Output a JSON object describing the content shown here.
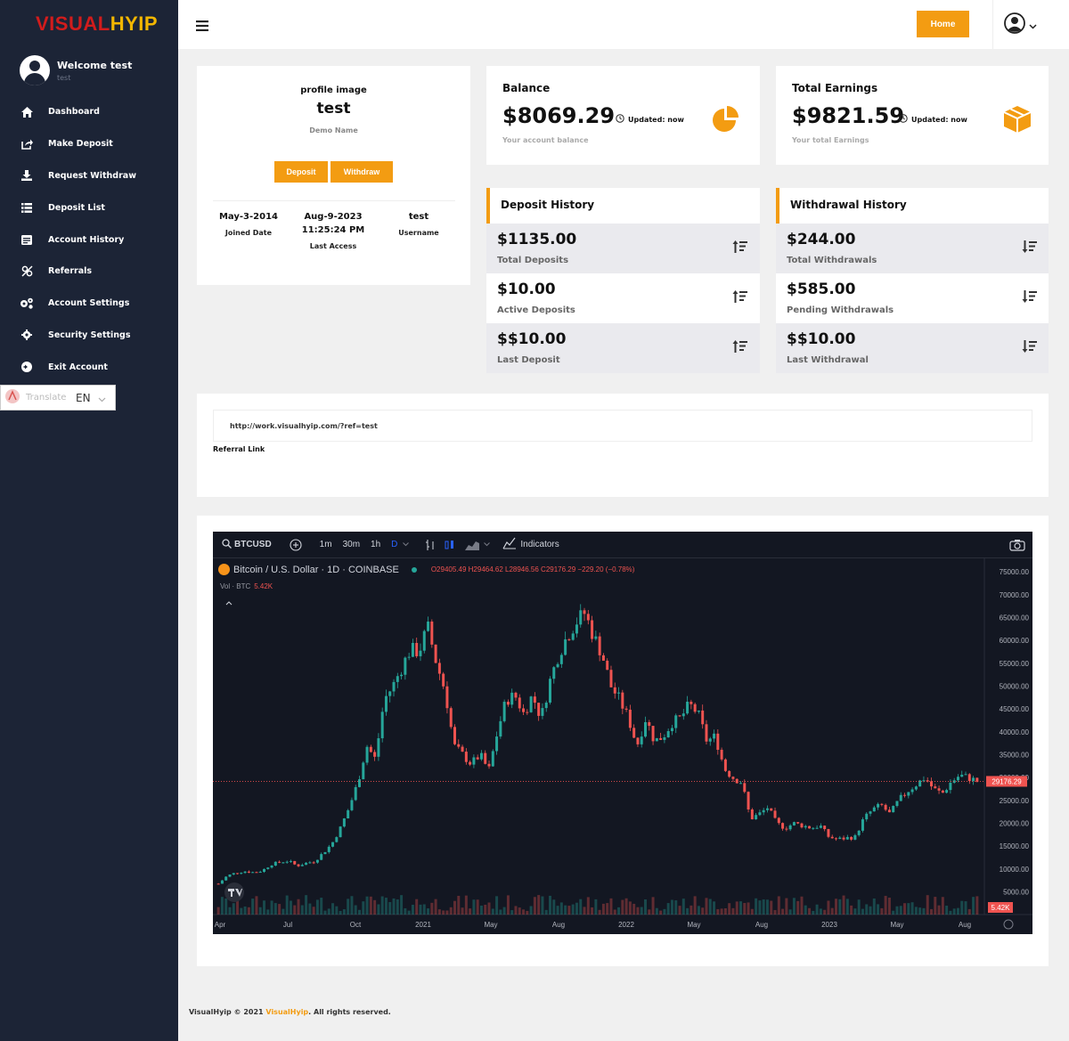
{
  "brand": {
    "part1": "VISUAL",
    "part2": "HYIP",
    "color1": "#d21c1c",
    "color2": "#f2b600"
  },
  "sidebar": {
    "welcome": "Welcome test",
    "username": "test",
    "items": [
      {
        "label": "Dashboard",
        "icon": "home-icon"
      },
      {
        "label": "Make Deposit",
        "icon": "share-icon"
      },
      {
        "label": "Request Withdraw",
        "icon": "download-icon"
      },
      {
        "label": "Deposit List",
        "icon": "list-icon"
      },
      {
        "label": "Account History",
        "icon": "history-icon"
      },
      {
        "label": "Referrals",
        "icon": "referrals-icon"
      },
      {
        "label": "Account Settings",
        "icon": "cogs-icon"
      },
      {
        "label": "Security Settings",
        "icon": "gear-icon"
      },
      {
        "label": "Exit Account",
        "icon": "exit-icon"
      }
    ],
    "translate": {
      "label": "Translate",
      "lang": "EN"
    }
  },
  "topbar": {
    "home_label": "Home",
    "accent": "#f39c12"
  },
  "profile": {
    "label": "profile image",
    "name": "test",
    "demo": "Demo Name",
    "deposit_btn": "Deposit",
    "withdraw_btn": "Withdraw",
    "joined_value": "May-3-2014",
    "joined_label": "Joined Date",
    "last_access_date": "Aug-9-2023",
    "last_access_time": "11:25:24 PM",
    "last_access_label": "Last Access",
    "username_value": "test",
    "username_label": "Username"
  },
  "balance": {
    "title": "Balance",
    "amount": "$8069.29",
    "updated": "Updated: now",
    "desc": "Your account balance"
  },
  "earnings": {
    "title": "Total Earnings",
    "amount": "$9821.59",
    "updated": "Updated: now",
    "desc": "Your total Earnings"
  },
  "deposit_history": {
    "title": "Deposit History",
    "rows": [
      {
        "amount": "$1135.00",
        "label": "Total Deposits"
      },
      {
        "amount": "$10.00",
        "label": "Active Deposits"
      },
      {
        "amount": "$$10.00",
        "label": "Last Deposit"
      }
    ]
  },
  "withdrawal_history": {
    "title": "Withdrawal History",
    "rows": [
      {
        "amount": "$244.00",
        "label": "Total Withdrawals"
      },
      {
        "amount": "$585.00",
        "label": "Pending Withdrawals"
      },
      {
        "amount": "$$10.00",
        "label": "Last Withdrawal"
      }
    ]
  },
  "referral": {
    "link": "http://work.visualhyip.com/?ref=test",
    "label": "Referral Link"
  },
  "tradingview": {
    "symbol": "BTCUSD",
    "intervals": [
      "1m",
      "30m",
      "1h",
      "D"
    ],
    "indicators_label": "Indicators",
    "legend_title": "Bitcoin / U.S. Dollar · 1D · COINBASE",
    "ohlc": "O29405.49 H29464.62 L28946.56 C29176.29 −229.20 (−0.78%)",
    "volume_label": "Vol · BTC",
    "volume_value": "5.42K",
    "last_price_label": "29176.29",
    "volume_badge": "5.42K",
    "up_color": "#26a69a",
    "down_color": "#ef5350"
  },
  "chart_data": {
    "type": "line",
    "title": "Bitcoin / U.S. Dollar · 1D · COINBASE",
    "xlabel": "",
    "ylabel": "",
    "x": [
      "Apr",
      "Jul",
      "Oct",
      "2021",
      "May",
      "Aug",
      "2022",
      "May",
      "Aug",
      "2023",
      "May",
      "Aug"
    ],
    "xtick_labels": [
      "Apr",
      "Jul",
      "Oct",
      "2021",
      "May",
      "Aug",
      "2022",
      "May",
      "Aug",
      "2023",
      "May",
      "Aug"
    ],
    "ytick_labels": [
      "75000.00",
      "70000.00",
      "65000.00",
      "60000.00",
      "55000.00",
      "50000.00",
      "45000.00",
      "40000.00",
      "35000.00",
      "30000.00",
      "25000.00",
      "20000.00",
      "15000.00",
      "10000.00",
      "5000.00"
    ],
    "ylim": [
      2000,
      76000
    ],
    "series": [
      {
        "name": "",
        "values": [
          6800,
          8500,
          9200,
          9500,
          9300,
          9600,
          11000,
          11500,
          11800,
          10700,
          11300,
          11700,
          13500,
          15500,
          19000,
          23500,
          29000,
          37000,
          34000,
          47000,
          50000,
          54000,
          58000,
          57500,
          63000,
          55000,
          49000,
          37000,
          35000,
          33000,
          35000,
          31500,
          40000,
          47000,
          48000,
          44000,
          48000,
          43000,
          51000,
          57000,
          61000,
          64000,
          66000,
          61000,
          57000,
          50000,
          47000,
          43000,
          37000,
          43000,
          38000,
          39000,
          42000,
          43000,
          46000,
          44000,
          38000,
          39000,
          32000,
          30000,
          29000,
          21000,
          22000,
          23500,
          20000,
          19000,
          20000,
          19500,
          19000,
          19500,
          17000,
          16500,
          16800,
          17000,
          21000,
          23000,
          24000,
          22000,
          25000,
          27000,
          28500,
          30000,
          27500,
          26500,
          29000,
          30500,
          30000,
          29176
        ]
      }
    ],
    "grid": false,
    "legend": "top-left"
  },
  "footer": {
    "prefix": "VisualHyip © 2021 ",
    "brand": "VisualHyip",
    "suffix": ". All rights reserved."
  }
}
